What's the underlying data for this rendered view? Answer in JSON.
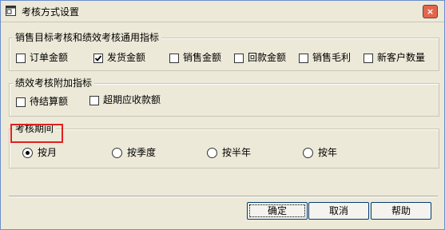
{
  "window": {
    "title": "考核方式设置",
    "close_glyph": "×"
  },
  "group_general": {
    "title": "销售目标考核和绩效考核通用指标",
    "items": [
      {
        "label": "订单金额",
        "checked": false
      },
      {
        "label": "发货金额",
        "checked": true
      },
      {
        "label": "销售金额",
        "checked": false
      },
      {
        "label": "回款金额",
        "checked": false
      },
      {
        "label": "销售毛利",
        "checked": false
      },
      {
        "label": "新客户数量",
        "checked": false
      }
    ]
  },
  "group_extra": {
    "title": "绩效考核附加指标",
    "items": [
      {
        "label": "待结算额",
        "checked": false
      },
      {
        "label": "超期应收款额",
        "checked": false
      }
    ]
  },
  "group_period": {
    "title": "考核期间",
    "options": [
      {
        "label": "按月",
        "selected": true
      },
      {
        "label": "按季度",
        "selected": false
      },
      {
        "label": "按半年",
        "selected": false
      },
      {
        "label": "按年",
        "selected": false
      }
    ]
  },
  "buttons": {
    "ok": "确定",
    "cancel": "取消",
    "help": "帮助"
  },
  "colors": {
    "highlight": "#e02020",
    "close": "#e2664d",
    "face": "#ece9d8"
  },
  "icons": {
    "app": "window-app-icon",
    "close": "close-icon",
    "check": "checkmark-icon"
  }
}
